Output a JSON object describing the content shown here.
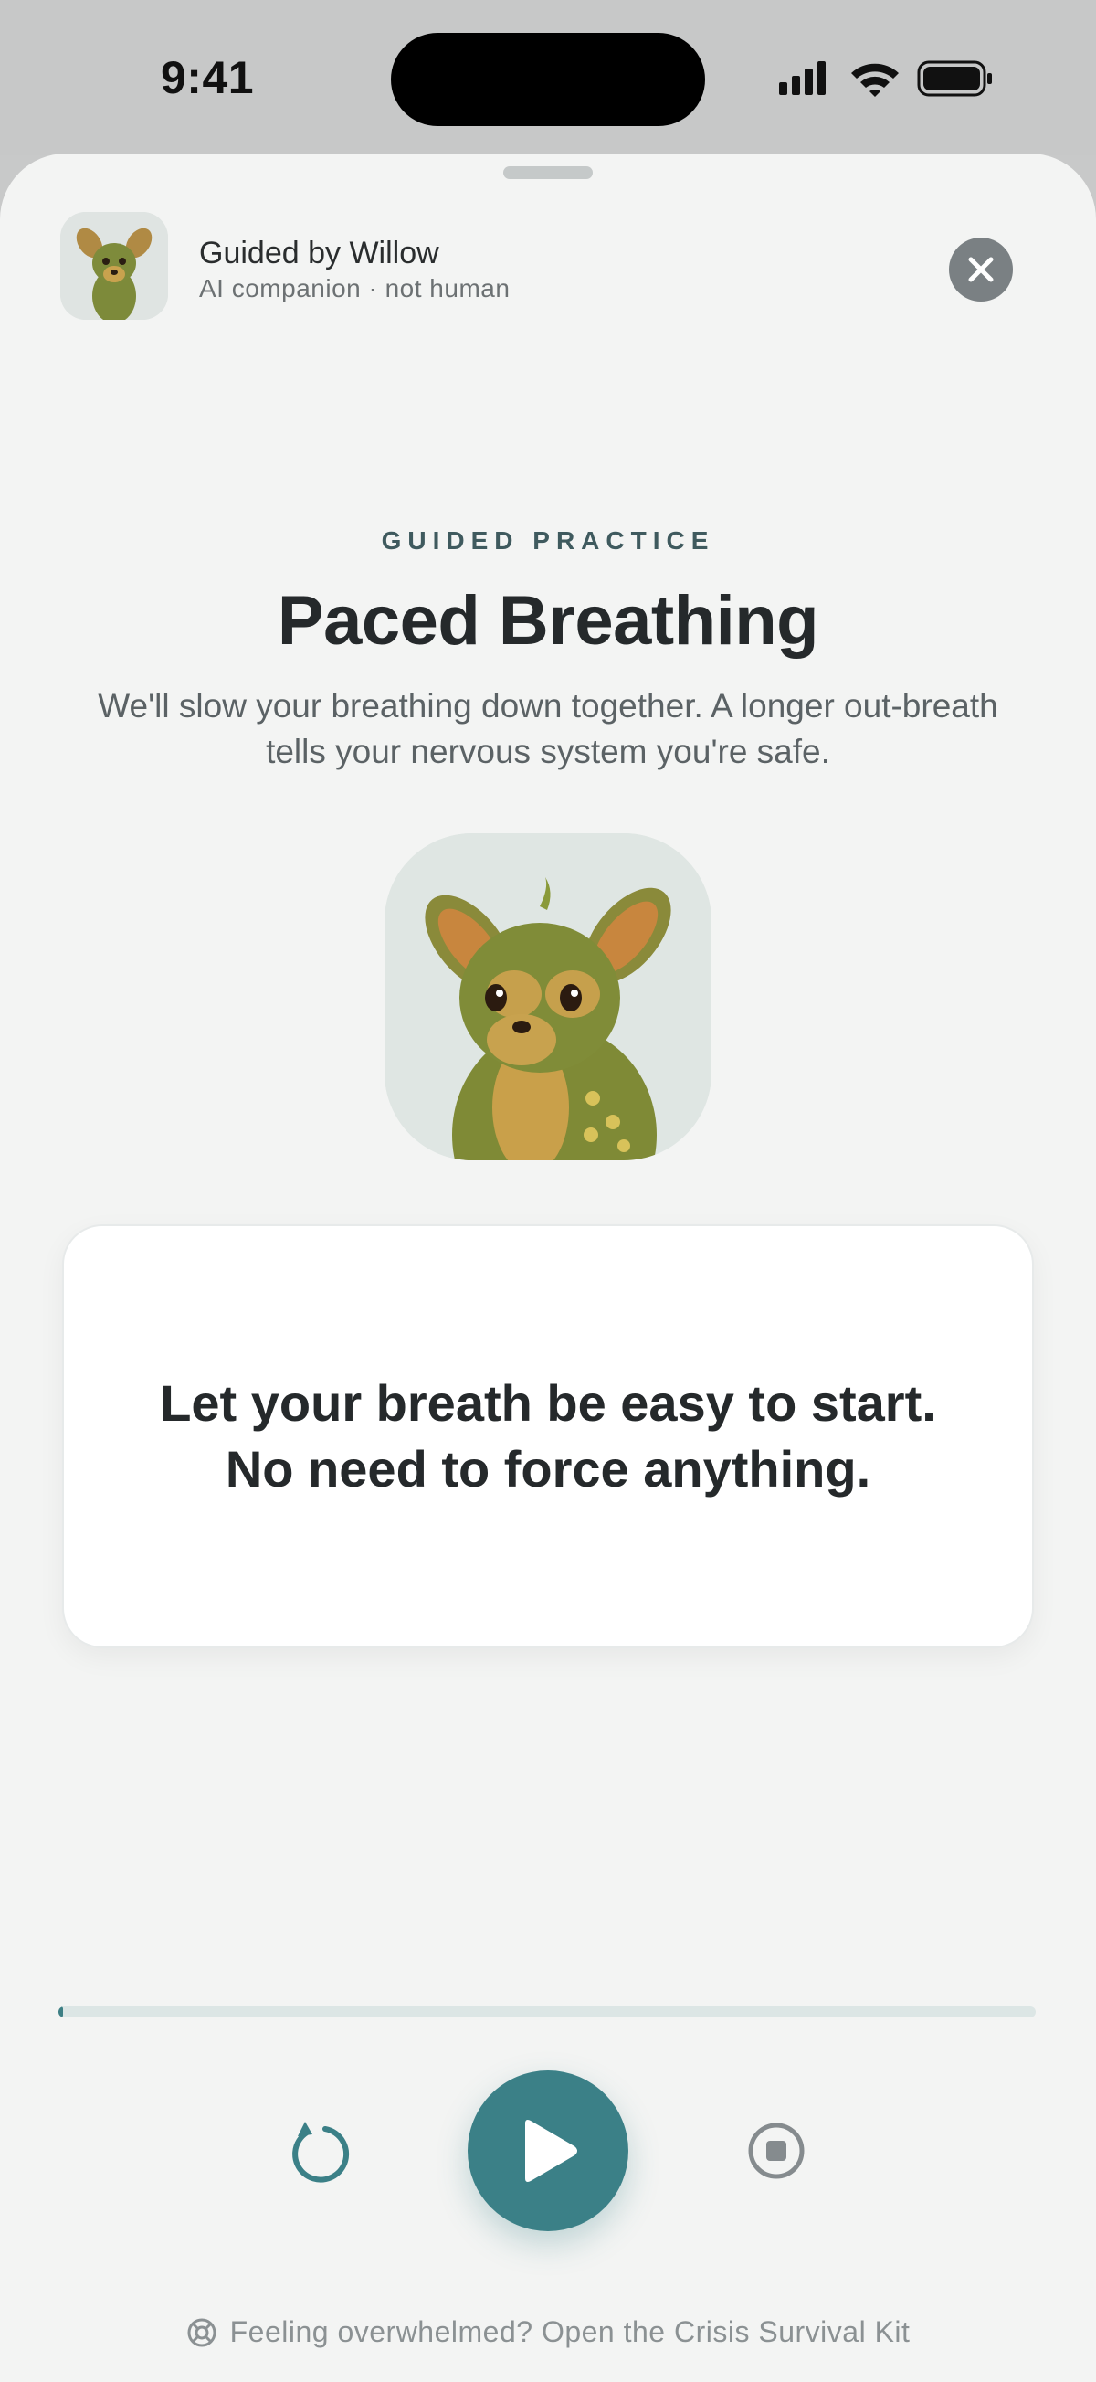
{
  "status_bar": {
    "time": "9:41"
  },
  "header": {
    "name": "Guided by Willow",
    "subtitle": "AI companion · not human"
  },
  "practice": {
    "eyebrow": "GUIDED PRACTICE",
    "title": "Paced Breathing",
    "description": "We'll slow your breathing down together. A longer out-breath tells your nervous system you're safe."
  },
  "prompt": {
    "line1": "Let your breath be easy to start.",
    "line2": "No need to force anything."
  },
  "player": {
    "progress_percent": 0.5
  },
  "footer": {
    "crisis_link": "Feeling overwhelmed? Open the Crisis Survival Kit"
  },
  "colors": {
    "accent": "#3b8087",
    "sheet_bg": "#f3f4f3",
    "text_primary": "#25292b"
  }
}
